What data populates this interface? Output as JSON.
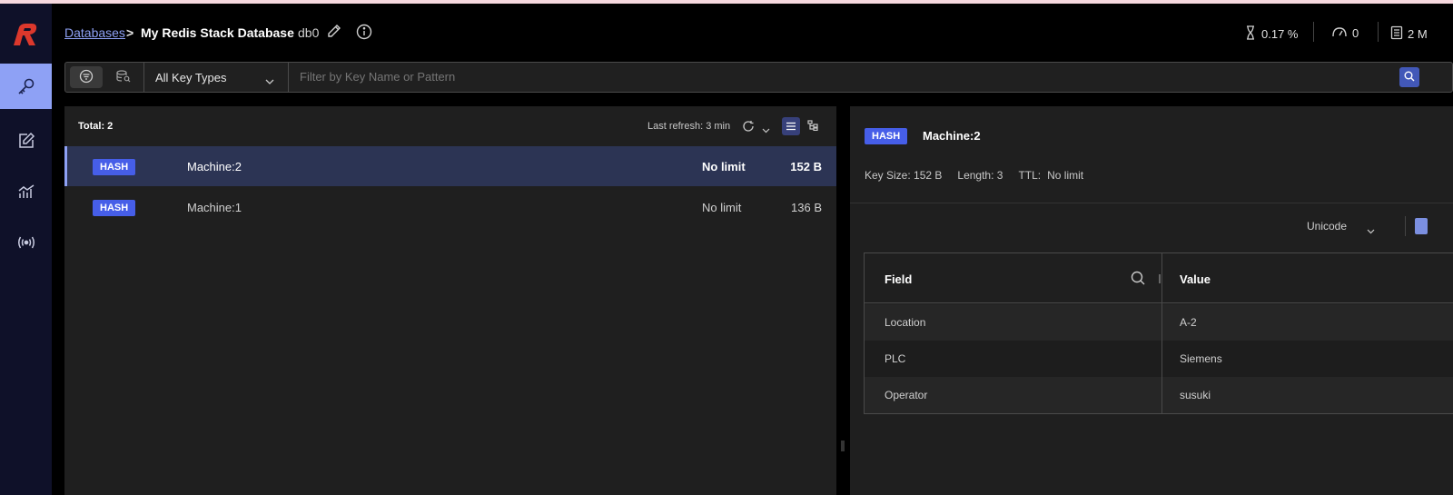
{
  "colors": {
    "accent": "#8ea1f5",
    "hash_badge": "#465ee8",
    "nav_bg": "#0f1129",
    "panel_bg": "#1f1f1f",
    "brand_red": "#dc382c"
  },
  "nav": {
    "logo_icon": "redis-logo-icon",
    "items": [
      {
        "icon": "key-icon",
        "active": true
      },
      {
        "icon": "edit-icon",
        "active": false
      },
      {
        "icon": "analytics-icon",
        "active": false
      },
      {
        "icon": "pubsub-icon",
        "active": false
      }
    ]
  },
  "header": {
    "breadcrumb_link": "Databases",
    "breadcrumb_sep": ">",
    "database_name": "My Redis Stack Database",
    "db_index": "db0",
    "stats": {
      "cpu": "0.17 %",
      "ops": "0",
      "memory": "2 M"
    }
  },
  "filter": {
    "key_type": "All Key Types",
    "search_placeholder": "Filter by Key Name or Pattern",
    "search_value": ""
  },
  "key_list": {
    "total": "Total: 2",
    "last_refresh": "Last refresh: 3 min",
    "rows": [
      {
        "type": "HASH",
        "name": "Machine:2",
        "ttl": "No limit",
        "size": "152 B",
        "selected": true
      },
      {
        "type": "HASH",
        "name": "Machine:1",
        "ttl": "No limit",
        "size": "136 B",
        "selected": false
      }
    ]
  },
  "details": {
    "type": "HASH",
    "key_name": "Machine:2",
    "key_size": "Key Size: 152 B",
    "length": "Length: 3",
    "ttl_label": "TTL:",
    "ttl_value": "No limit",
    "format": "Unicode",
    "table": {
      "headers": {
        "field": "Field",
        "value": "Value"
      },
      "rows": [
        {
          "field": "Location",
          "value": "A-2"
        },
        {
          "field": "PLC",
          "value": "Siemens"
        },
        {
          "field": "Operator",
          "value": "susuki"
        }
      ]
    }
  }
}
